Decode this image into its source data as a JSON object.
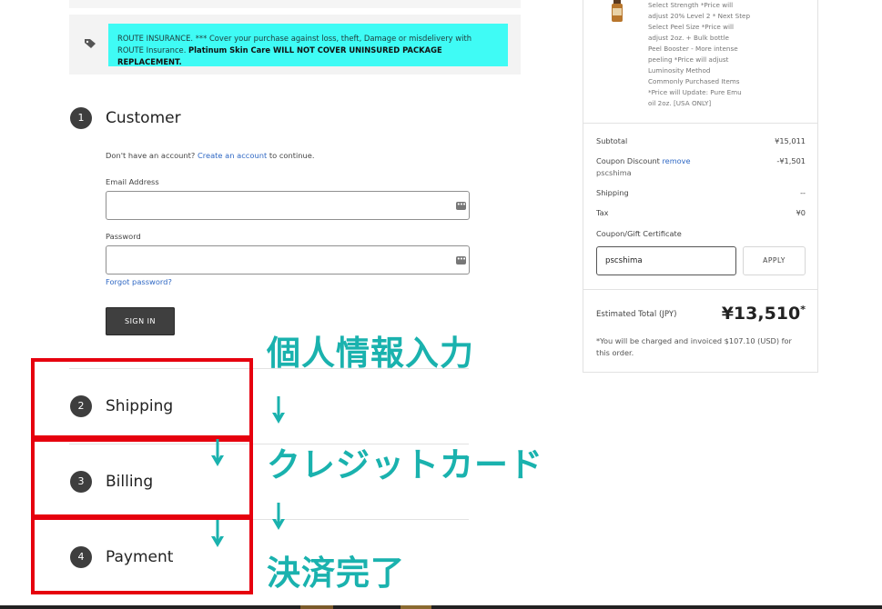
{
  "route": {
    "line1": "ROUTE INSURANCE. *** Cover your purchase against loss, theft, Damage or misdelivery with",
    "line2_plain": "ROUTE Insurance. ",
    "line2_bold": "Platinum Skin Care WILL NOT COVER UNINSURED PACKAGE REPLACEMENT."
  },
  "steps": [
    {
      "number": "1",
      "title": "Customer"
    },
    {
      "number": "2",
      "title": "Shipping"
    },
    {
      "number": "3",
      "title": "Billing"
    },
    {
      "number": "4",
      "title": "Payment"
    }
  ],
  "customer": {
    "no_account_text": "Don't have an account? ",
    "create_account_link": "Create an account",
    "continue_text": " to continue.",
    "email_label": "Email Address",
    "email_value": "",
    "password_label": "Password",
    "password_value": "",
    "forgot_password": "Forgot password?",
    "sign_in": "SIGN IN"
  },
  "annotations": {
    "step1": "個人情報入力",
    "step2": "クレジットカード",
    "step3": "決済完了"
  },
  "product_options": [
    "Select Strength *Price will",
    "adjust 20% Level 2 * Next Step",
    "Select Peel Size *Price will",
    "adjust 2oz. + Bulk bottle",
    "Peel Booster - More intense",
    "peeling *Price will adjust",
    "Luminosity Method",
    "Commonly Purchased Items",
    "*Price will Update: Pure Emu",
    "oil 2oz. [USA ONLY]"
  ],
  "summary": {
    "subtotal_label": "Subtotal",
    "subtotal_value": "¥15,011",
    "coupon_label": "Coupon Discount ",
    "coupon_remove": "remove",
    "coupon_code": "pscshima",
    "coupon_value": "-¥1,501",
    "shipping_label": "Shipping",
    "shipping_value": "--",
    "tax_label": "Tax",
    "tax_value": "¥0",
    "gift_label": "Coupon/Gift Certificate",
    "gift_input_value": "pscshima",
    "apply_label": "APPLY",
    "total_label": "Estimated Total (JPY)",
    "total_value": "¥13,510",
    "total_asterisk": "*",
    "charge_note_line1": "*You will be charged and invoiced $107.10 (USD) for",
    "charge_note_line2": "this order."
  },
  "colors": {
    "route_bg": "#3ffbf5",
    "annotation_teal": "#1ab2ae",
    "highlight_red": "#e6000e",
    "link_blue": "#2f68c4"
  }
}
